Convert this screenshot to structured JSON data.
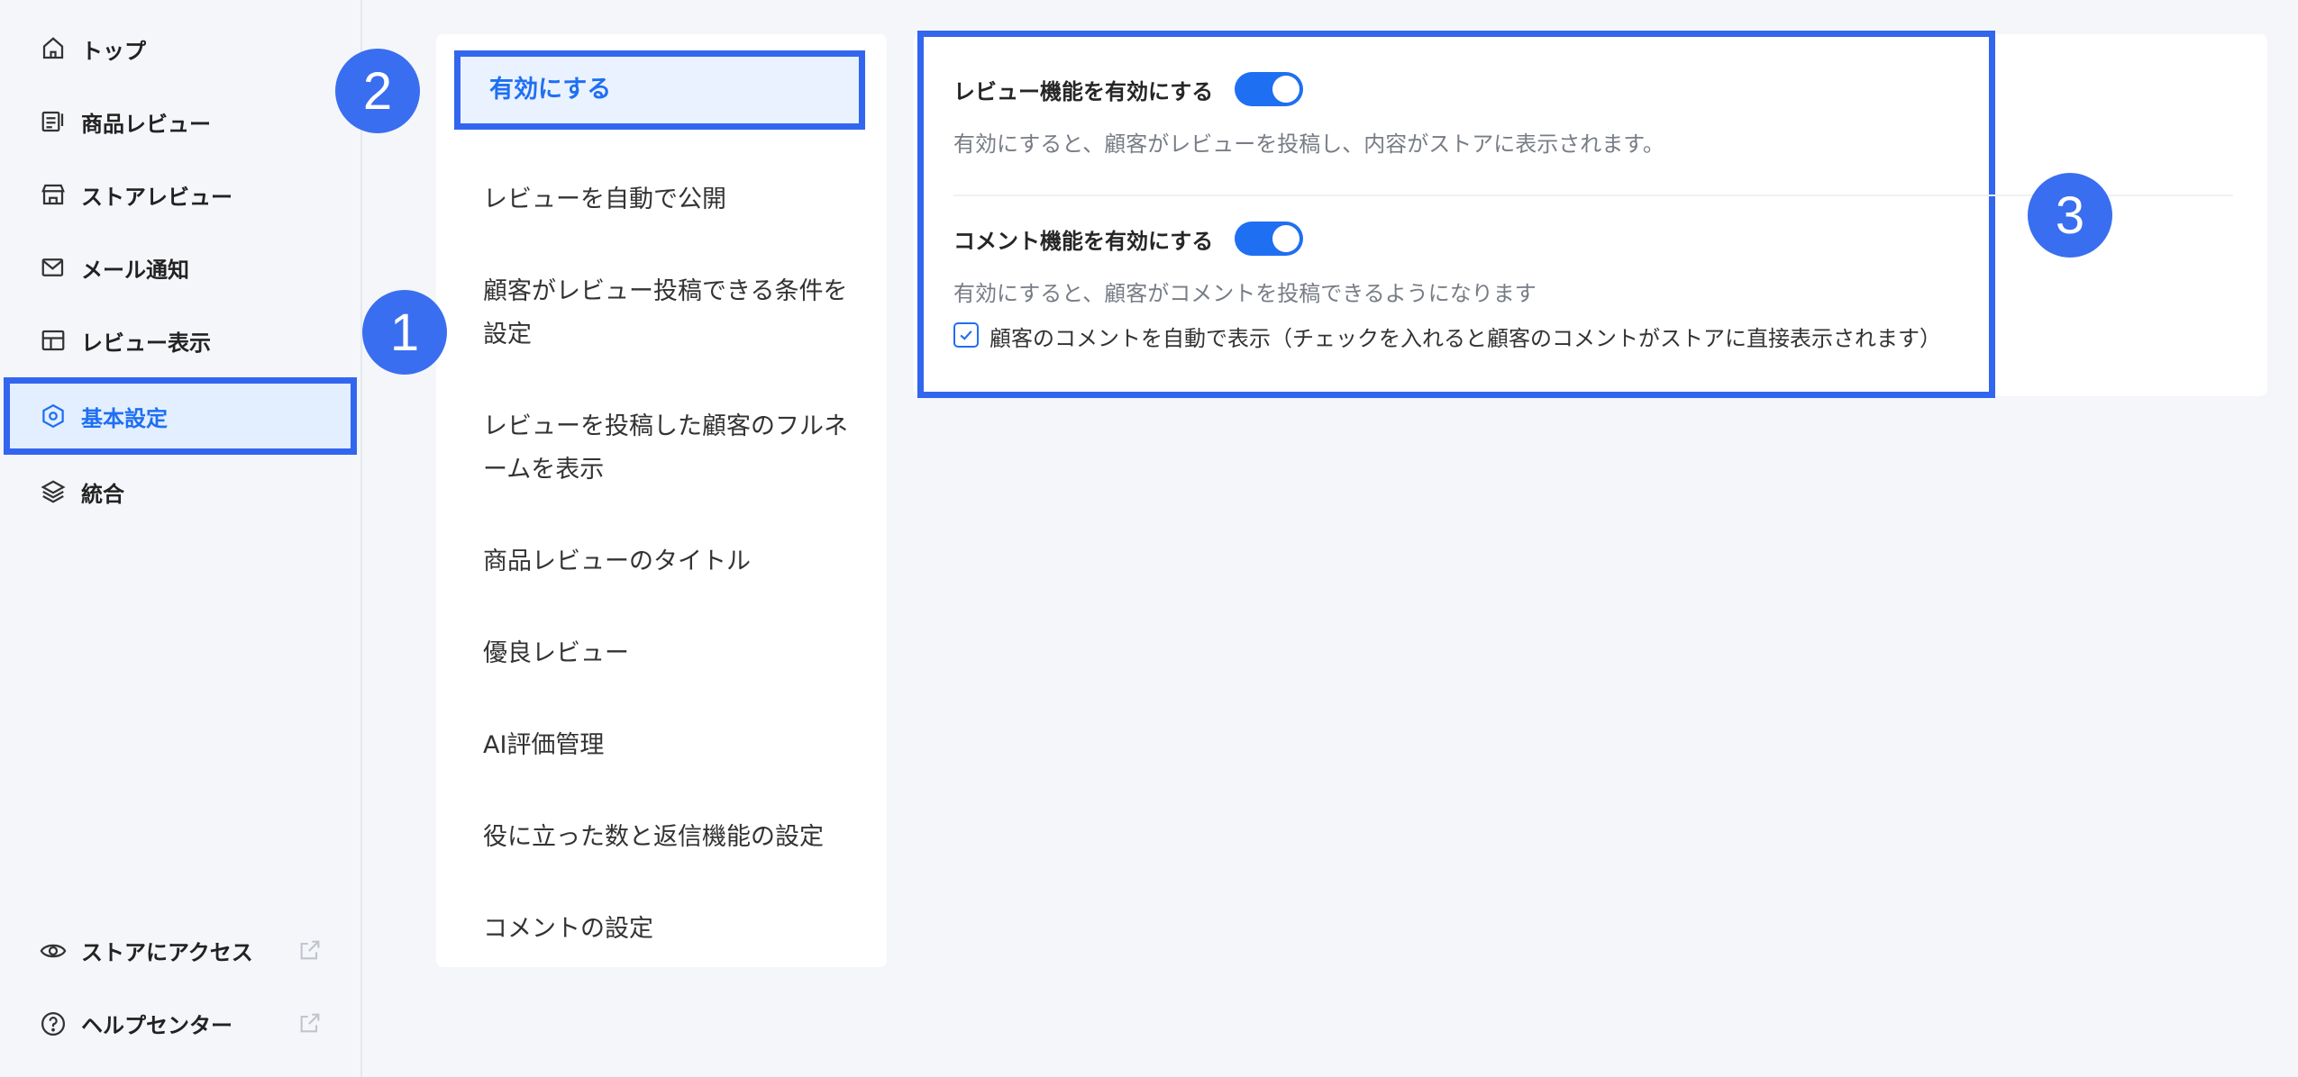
{
  "sidebar": {
    "items": [
      {
        "label": "トップ",
        "icon": "home-icon"
      },
      {
        "label": "商品レビュー",
        "icon": "product-review-icon"
      },
      {
        "label": "ストアレビュー",
        "icon": "store-icon"
      },
      {
        "label": "メール通知",
        "icon": "mail-icon"
      },
      {
        "label": "レビュー表示",
        "icon": "layout-icon"
      },
      {
        "label": "基本設定",
        "icon": "settings-icon"
      },
      {
        "label": "統合",
        "icon": "layers-icon"
      }
    ],
    "bottom": [
      {
        "label": "ストアにアクセス",
        "icon": "eye-icon"
      },
      {
        "label": "ヘルプセンター",
        "icon": "help-icon"
      }
    ]
  },
  "menu": {
    "items": [
      "有効にする",
      "レビューを自動で公開",
      "顧客がレビュー投稿できる条件を設定",
      "レビューを投稿した顧客のフルネームを表示",
      "商品レビューのタイトル",
      "優良レビュー",
      "AI評価管理",
      "役に立った数と返信機能の設定",
      "コメントの設定"
    ]
  },
  "settings": {
    "review": {
      "title": "レビュー機能を有効にする",
      "desc": "有効にすると、顧客がレビューを投稿し、内容がストアに表示されます。",
      "enabled": true
    },
    "comment": {
      "title": "コメント機能を有効にする",
      "desc": "有効にすると、顧客がコメントを投稿できるようになります",
      "enabled": true,
      "auto_show_label": "顧客のコメントを自動で表示（チェックを入れると顧客のコメントがストアに直接表示されます）",
      "auto_show_checked": true
    }
  },
  "badges": [
    "1",
    "2",
    "3"
  ],
  "colors": {
    "accent": "#1f6ff2",
    "highlight": "#3366ee",
    "badge": "#3a6ef0"
  }
}
